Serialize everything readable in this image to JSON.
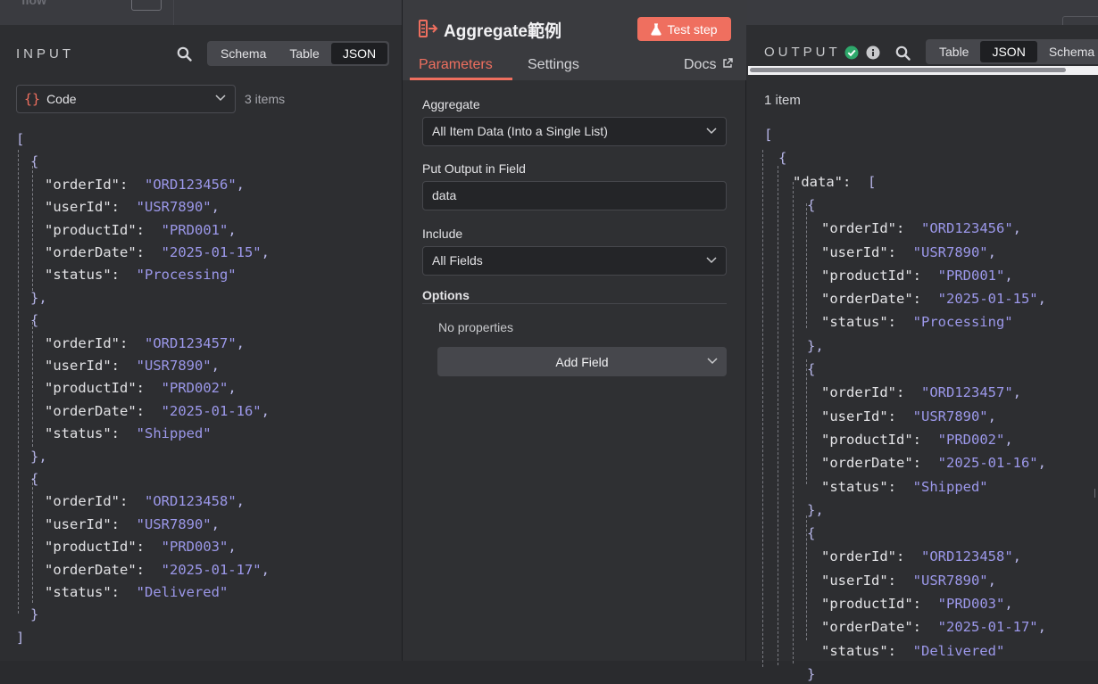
{
  "background": {
    "crumb": "flow"
  },
  "input": {
    "title": "INPUT",
    "tabs": [
      "Schema",
      "Table",
      "JSON"
    ],
    "active_tab": "JSON",
    "source_select": "Code",
    "items_count": "3 items",
    "json_lines": [
      "[",
      "{",
      "\"orderId\": \"ORD123456\",",
      "\"userId\": \"USR7890\",",
      "\"productId\": \"PRD001\",",
      "\"orderDate\": \"2025-01-15\",",
      "\"status\": \"Processing\"",
      "},",
      "{",
      "\"orderId\": \"ORD123457\",",
      "\"userId\": \"USR7890\",",
      "\"productId\": \"PRD002\",",
      "\"orderDate\": \"2025-01-16\",",
      "\"status\": \"Shipped\"",
      "},",
      "{",
      "\"orderId\": \"ORD123458\",",
      "\"userId\": \"USR7890\",",
      "\"productId\": \"PRD003\",",
      "\"orderDate\": \"2025-01-17\",",
      "\"status\": \"Delivered\"",
      "}",
      "]"
    ]
  },
  "node": {
    "title": "Aggregate範例",
    "test_button": "Test step",
    "tabs": {
      "parameters": "Parameters",
      "settings": "Settings",
      "docs": "Docs"
    },
    "aggregate_label": "Aggregate",
    "aggregate_value": "All Item Data (Into a Single List)",
    "output_field_label": "Put Output in Field",
    "output_field_value": "data",
    "include_label": "Include",
    "include_value": "All Fields",
    "options_label": "Options",
    "no_properties": "No properties",
    "add_field": "Add Field"
  },
  "output": {
    "title": "OUTPUT",
    "tabs": [
      "Table",
      "JSON",
      "Schema"
    ],
    "active_tab": "JSON",
    "items_count": "1 item",
    "json_lines": [
      "[",
      "{",
      "\"data\": [",
      "{",
      "\"orderId\": \"ORD123456\",",
      "\"userId\": \"USR7890\",",
      "\"productId\": \"PRD001\",",
      "\"orderDate\": \"2025-01-15\",",
      "\"status\": \"Processing\"",
      "},",
      "{",
      "\"orderId\": \"ORD123457\",",
      "\"userId\": \"USR7890\",",
      "\"productId\": \"PRD002\",",
      "\"orderDate\": \"2025-01-16\",",
      "\"status\": \"Shipped\"",
      "},",
      "{",
      "\"orderId\": \"ORD123458\",",
      "\"userId\": \"USR7890\",",
      "\"productId\": \"PRD003\",",
      "\"orderDate\": \"2025-01-17\",",
      "\"status\": \"Delivered\"",
      "}"
    ]
  },
  "colors": {
    "accent": "#ef6f5f",
    "string": "#9c98ea",
    "success": "#2ea86b"
  }
}
